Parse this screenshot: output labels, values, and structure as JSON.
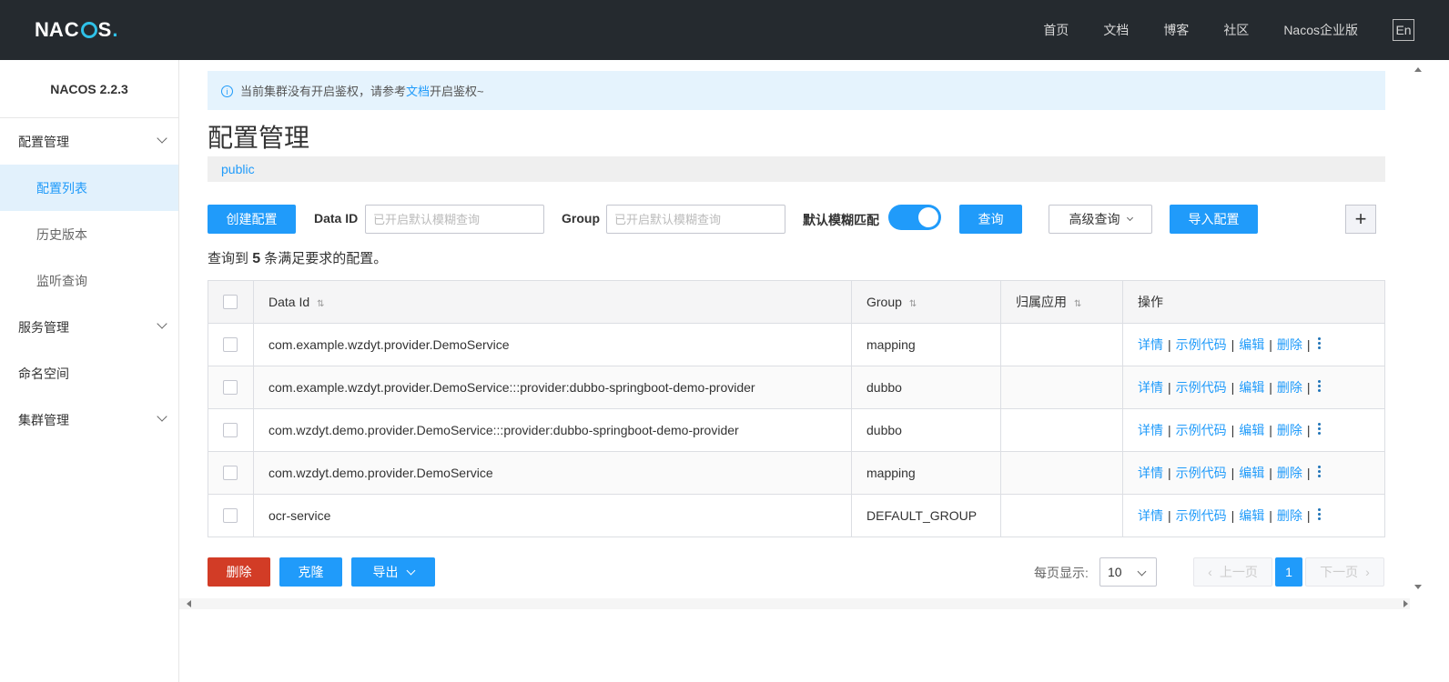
{
  "header": {
    "logo_text": "NACOS.",
    "nav": [
      "首页",
      "文档",
      "博客",
      "社区",
      "Nacos企业版"
    ],
    "lang": "En"
  },
  "sidebar": {
    "version": "NACOS 2.2.3",
    "items": [
      {
        "label": "配置管理",
        "expandable": true
      },
      {
        "label": "配置列表",
        "active": true
      },
      {
        "label": "历史版本"
      },
      {
        "label": "监听查询"
      },
      {
        "label": "服务管理",
        "expandable": true
      },
      {
        "label": "命名空间"
      },
      {
        "label": "集群管理",
        "expandable": true
      }
    ]
  },
  "notice": {
    "prefix": "当前集群没有开启鉴权，请参考",
    "link": "文档",
    "suffix": "开启鉴权~"
  },
  "page_title": "配置管理",
  "namespace": "public",
  "toolbar": {
    "create_label": "创建配置",
    "data_id_label": "Data ID",
    "data_id_placeholder": "已开启默认模糊查询",
    "group_label": "Group",
    "group_placeholder": "已开启默认模糊查询",
    "fuzzy_label": "默认模糊匹配",
    "fuzzy_on": true,
    "query_label": "查询",
    "advanced_label": "高级查询",
    "import_label": "导入配置",
    "plus": "+"
  },
  "summary": {
    "prefix": "查询到",
    "count": "5",
    "suffix": "条满足要求的配置。"
  },
  "table": {
    "headers": {
      "data_id": "Data Id",
      "group": "Group",
      "app": "归属应用",
      "ops": "操作"
    },
    "sort_icon": "⇅",
    "rows": [
      {
        "data_id": "com.example.wzdyt.provider.DemoService",
        "group": "mapping",
        "app": ""
      },
      {
        "data_id": "com.example.wzdyt.provider.DemoService:::provider:dubbo-springboot-demo-provider",
        "group": "dubbo",
        "app": ""
      },
      {
        "data_id": "com.wzdyt.demo.provider.DemoService:::provider:dubbo-springboot-demo-provider",
        "group": "dubbo",
        "app": ""
      },
      {
        "data_id": "com.wzdyt.demo.provider.DemoService",
        "group": "mapping",
        "app": ""
      },
      {
        "data_id": "ocr-service",
        "group": "DEFAULT_GROUP",
        "app": ""
      }
    ],
    "ops": {
      "detail": "详情",
      "sample": "示例代码",
      "edit": "编辑",
      "delete": "删除",
      "sep": "|"
    }
  },
  "bottom": {
    "delete_label": "删除",
    "clone_label": "克隆",
    "export_label": "导出",
    "page_size_label": "每页显示:",
    "page_size": "10",
    "prev_label": "上一页",
    "current_page": "1",
    "next_label": "下一页"
  },
  "colors": {
    "primary": "#209bfa",
    "danger": "#d23c26",
    "header_bg": "#252a2f"
  }
}
